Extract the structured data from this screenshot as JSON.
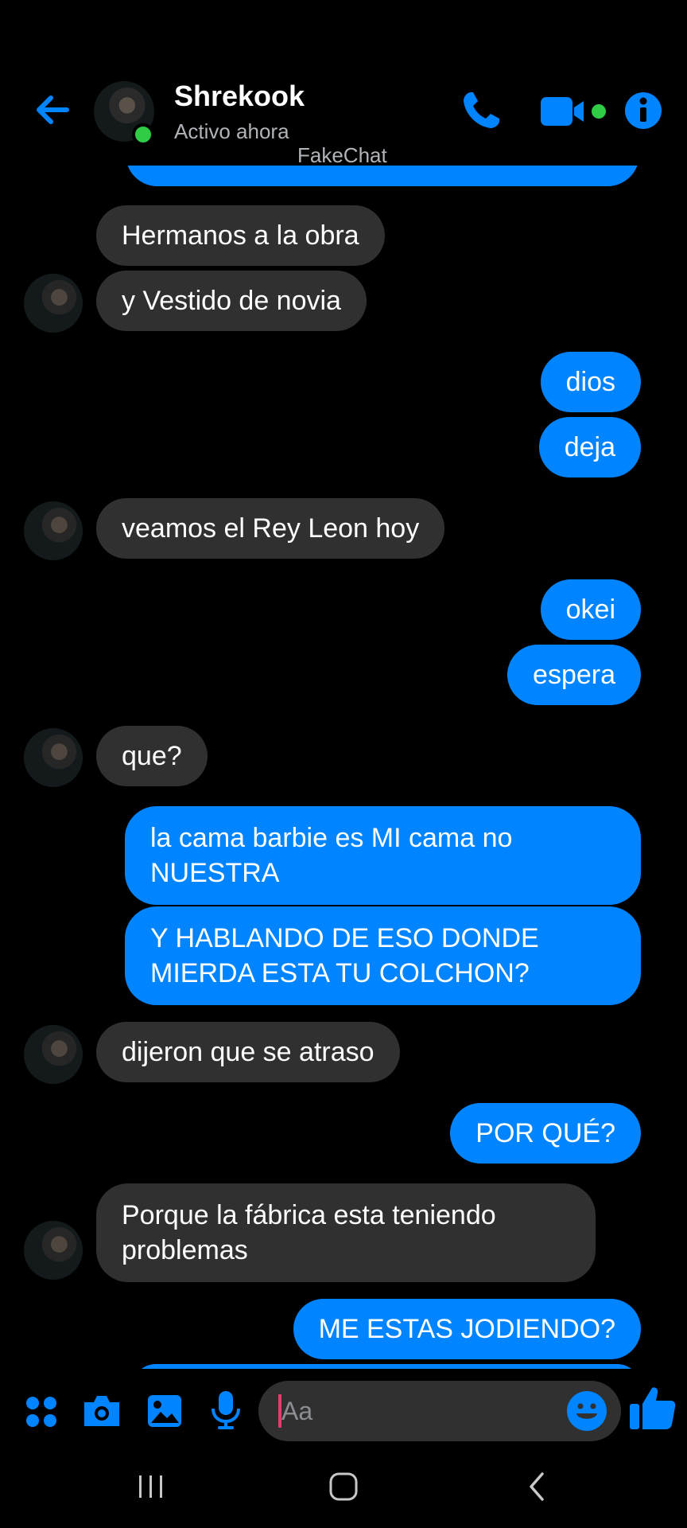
{
  "header": {
    "contact_name": "Shrekook",
    "status": "Activo ahora",
    "watermark": "FakeChat",
    "icons": [
      "back-arrow-icon",
      "phone-icon",
      "video-camera-icon",
      "info-icon"
    ],
    "accent_color": "#0084ff",
    "online_color": "#31cc46"
  },
  "messages": [
    {
      "from": "contact",
      "text": "Hermanos a la obra"
    },
    {
      "from": "contact",
      "text": "y Vestido de novia"
    },
    {
      "from": "me",
      "text": "dios"
    },
    {
      "from": "me",
      "text": "deja"
    },
    {
      "from": "contact",
      "text": "veamos el Rey Leon hoy"
    },
    {
      "from": "me",
      "text": "okei"
    },
    {
      "from": "me",
      "text": "espera"
    },
    {
      "from": "contact",
      "text": "que?"
    },
    {
      "from": "me",
      "text": "la cama barbie es MI cama no NUESTRA"
    },
    {
      "from": "me",
      "text": "Y HABLANDO DE ESO DONDE MIERDA ESTA TU COLCHON?"
    },
    {
      "from": "contact",
      "text": "dijeron que se atraso"
    },
    {
      "from": "me",
      "text": "POR QUÉ?"
    },
    {
      "from": "contact",
      "text": "Porque la fábrica esta teniendo problemas"
    },
    {
      "from": "me",
      "text": "ME ESTAS JODIENDO?"
    }
  ],
  "composer": {
    "placeholder": "Aa",
    "icons": [
      "apps-grid-icon",
      "camera-icon",
      "image-icon",
      "microphone-icon",
      "emoji-icon",
      "thumbs-up-icon"
    ]
  },
  "navbar": {
    "icons": [
      "recent-apps-icon",
      "home-icon",
      "back-nav-icon"
    ]
  }
}
